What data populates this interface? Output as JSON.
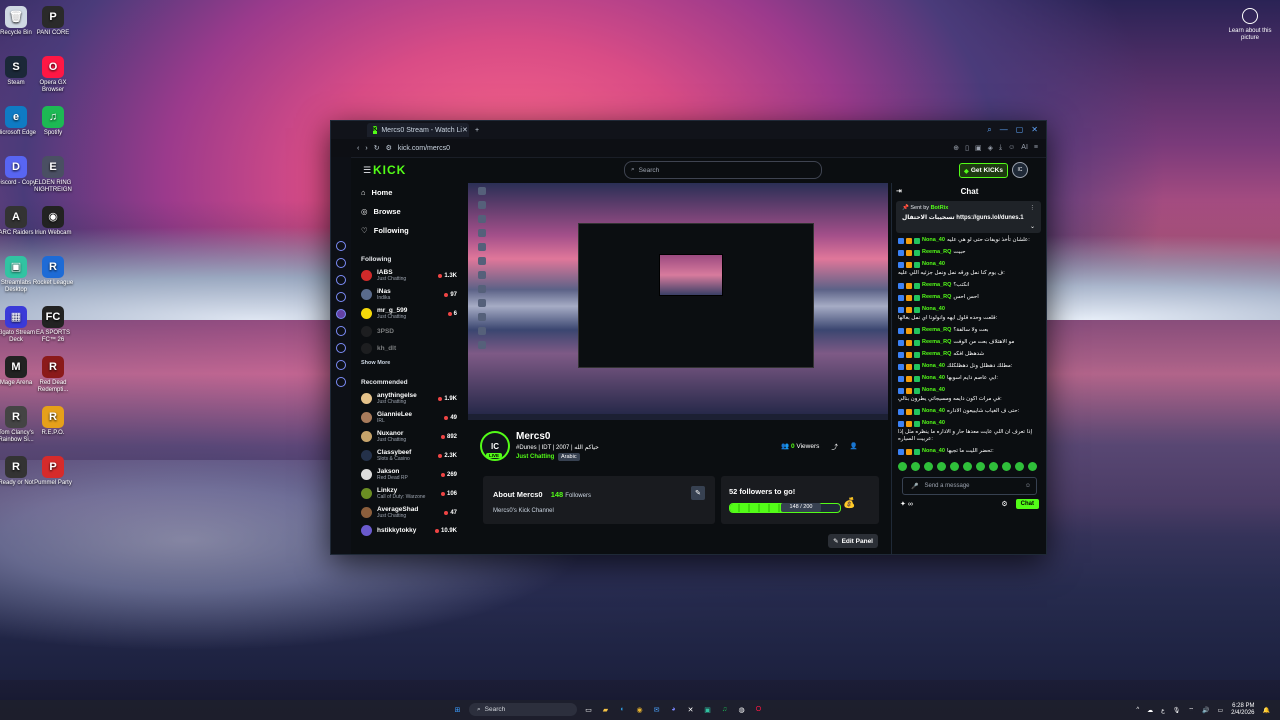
{
  "desktop": {
    "icons": [
      {
        "label": "Recycle Bin",
        "color": "#cfd8e3",
        "glyph": "🗑"
      },
      {
        "label": "PANI CORE",
        "color": "#2a2a2a",
        "glyph": "P"
      },
      {
        "label": "Steam",
        "color": "#1b2838",
        "glyph": "S"
      },
      {
        "label": "Opera GX Browser",
        "color": "#ff1744",
        "glyph": "O"
      },
      {
        "label": "Microsoft Edge",
        "color": "#0f7bc4",
        "glyph": "e"
      },
      {
        "label": "Spotify",
        "color": "#1db954",
        "glyph": "♫"
      },
      {
        "label": "Discord - Copy",
        "color": "#5865f2",
        "glyph": "D"
      },
      {
        "label": "ELDEN RING NIGHTREIGN",
        "color": "#4a4f63",
        "glyph": "E"
      },
      {
        "label": "ARC Raiders",
        "color": "#333",
        "glyph": "A"
      },
      {
        "label": "Iriun Webcam",
        "color": "#222",
        "glyph": "◉"
      },
      {
        "label": "Streamlabs Desktop",
        "color": "#31c3a2",
        "glyph": "▣"
      },
      {
        "label": "Rocket League",
        "color": "#1e6bd6",
        "glyph": "R"
      },
      {
        "label": "Elgato Stream Deck",
        "color": "#3a3ad8",
        "glyph": "▦"
      },
      {
        "label": "EA SPORTS FC™ 26",
        "color": "#222",
        "glyph": "FC"
      },
      {
        "label": "Mage Arena",
        "color": "#222",
        "glyph": "M"
      },
      {
        "label": "Red Dead Redempti...",
        "color": "#8b1a1a",
        "glyph": "R"
      },
      {
        "label": "Tom Clancy's Rainbow Si...",
        "color": "#444",
        "glyph": "R"
      },
      {
        "label": "R.E.P.O.",
        "color": "#e6a01a",
        "glyph": "R"
      },
      {
        "label": "Ready or Not",
        "color": "#333",
        "glyph": "R"
      },
      {
        "label": "Pummel Party",
        "color": "#d62b2b",
        "glyph": "P"
      }
    ],
    "learn_about": "Learn about this picture"
  },
  "browser": {
    "tab_title": "Mercs0 Stream - Watch Li",
    "url": "kick.com/mercs0",
    "ai_label": "AI"
  },
  "kick": {
    "logo": "KICK",
    "search_placeholder": "Search",
    "get_kicks": "Get KICKs",
    "nav": {
      "home": "Home",
      "browse": "Browse",
      "following": "Following"
    },
    "following_label": "Following",
    "following": [
      {
        "name": "IABS",
        "sub": "Just Chatting",
        "count": "1.3K",
        "color": "#d12a2a"
      },
      {
        "name": "iNas",
        "sub": "Indika",
        "count": "97",
        "color": "#5a6b8c"
      },
      {
        "name": "mr_g_599",
        "sub": "Just Chatting",
        "count": "6",
        "color": "#f5d90a"
      },
      {
        "name": "3PSD",
        "sub": "",
        "count": "",
        "color": "#333"
      },
      {
        "name": "kh_dlt",
        "sub": "",
        "count": "",
        "color": "#333"
      }
    ],
    "show_more": "Show More",
    "recommended_label": "Recommended",
    "recommended": [
      {
        "name": "anythingelse",
        "sub": "Just Chatting",
        "count": "1.9K",
        "color": "#e5c28a"
      },
      {
        "name": "GiannieLee",
        "sub": "IRL",
        "count": "49",
        "color": "#a87b5b"
      },
      {
        "name": "Nuxanor",
        "sub": "Just Chatting",
        "count": "892",
        "color": "#c7a46b"
      },
      {
        "name": "Classybeef",
        "sub": "Slots & Casino",
        "count": "2.3K",
        "color": "#24314a"
      },
      {
        "name": "Jakson",
        "sub": "Red Dead RP",
        "count": "269",
        "color": "#ddd"
      },
      {
        "name": "Linkzy",
        "sub": "Call of Duty: Warzone",
        "count": "106",
        "color": "#6b8e23"
      },
      {
        "name": "AverageShad",
        "sub": "Just Chatting",
        "count": "47",
        "color": "#8b5e3c"
      },
      {
        "name": "hstikkytokky",
        "sub": "",
        "count": "10.9K",
        "color": "#6a5acd"
      }
    ],
    "channel": {
      "avatar_text": "lC",
      "live": "LIVE",
      "name": "Mercs0",
      "title": "#Dunes | IDT | 2007 | حياكم الله",
      "category": "Just Chatting",
      "language": "Arabic",
      "viewers": "0",
      "viewers_label": "Viewers"
    },
    "about": {
      "title": "About Mercs0",
      "followers": "148",
      "followers_label": "Followers",
      "description": "Mercs0's Kick Channel"
    },
    "goal": {
      "title": "52 followers to go!",
      "current": 148,
      "target": 200,
      "label": "148 / 200"
    },
    "edit_panel": "Edit Panel"
  },
  "chat": {
    "title": "Chat",
    "pinned_sent_by": "Sent by",
    "pinned_user": "BotRix",
    "pinned_message": "تسحيبات الاحتفال https://guns.lol/dunes.1",
    "messages": [
      {
        "user": "Nona_40",
        "color": "#53fc18",
        "text": "علشان تأخذ نويفات حتى لو هي عليه:"
      },
      {
        "user": "Reema_RQ",
        "color": "#53fc18",
        "text": "حبيت"
      },
      {
        "user": "Nona_40",
        "color": "#53fc18",
        "text": "ف يوم كنا نمل ورقه نمل ونمل جزئيه اللي عليه:"
      },
      {
        "user": "Reema_RQ",
        "color": "#53fc18",
        "text": "انكتب؟"
      },
      {
        "user": "Reema_RQ",
        "color": "#53fc18",
        "text": "احس احس"
      },
      {
        "user": "Nona_40",
        "color": "#53fc18",
        "text": "قلعت وحده قلول ايهه وانولونا اي نمل بغالها:"
      },
      {
        "user": "Reema_RQ",
        "color": "#53fc18",
        "text": "بعت ولا سالفة؟"
      },
      {
        "user": "Reema_RQ",
        "color": "#53fc18",
        "text": "مو الاهتلاف بعت من الوفت"
      },
      {
        "user": "Reema_RQ",
        "color": "#53fc18",
        "text": "شدهظل افكه"
      },
      {
        "user": "Nona_40",
        "color": "#53fc18",
        "text": "مطلك دهظلل ونل دهظلكلك:"
      },
      {
        "user": "Nona_40",
        "color": "#53fc18",
        "text": "ابي عاصم دايم اسوبها:"
      },
      {
        "user": "Nona_40",
        "color": "#53fc18",
        "text": "في مرات اكون دايمه ومسيجاتي يطرون بنالي:"
      },
      {
        "user": "Nona_40",
        "color": "#53fc18",
        "text": "حتى ف الغياب شايبيعون الاداره:"
      },
      {
        "user": "Nona_40",
        "color": "#53fc18",
        "text": "إذا تعرف ان اللي عايت معدها حار و الاداره ما ينظره مثل إذا عربيت السياره:"
      },
      {
        "user": "Nona_40",
        "color": "#53fc18",
        "text": "تحضر الليت ما تجيها:"
      }
    ],
    "placeholder": "Send a message",
    "send_label": "Chat",
    "infinity": "∞"
  },
  "taskbar": {
    "search": "Search",
    "time": "6:28 PM",
    "date": "2/4/2026"
  }
}
